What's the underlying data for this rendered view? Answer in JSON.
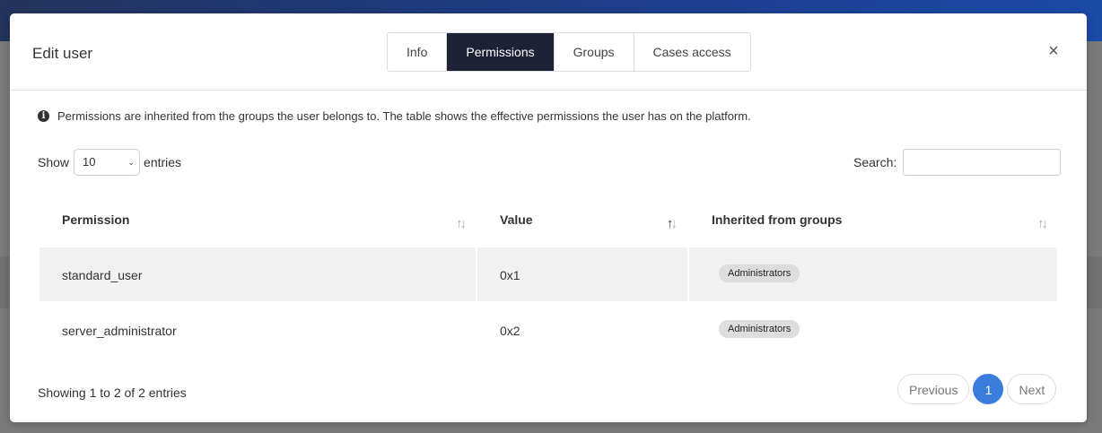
{
  "modal": {
    "title": "Edit user",
    "tabs": [
      {
        "label": "Info",
        "active": false
      },
      {
        "label": "Permissions",
        "active": true
      },
      {
        "label": "Groups",
        "active": false
      },
      {
        "label": "Cases access",
        "active": false
      }
    ],
    "close_symbol": "×"
  },
  "notice": {
    "icon": "info-circle-icon",
    "text": "Permissions are inherited from the groups the user belongs to. The table shows the effective permissions the user has on the platform."
  },
  "length_control": {
    "prefix": "Show",
    "selected": "10",
    "suffix": "entries"
  },
  "search": {
    "label": "Search:",
    "value": ""
  },
  "table": {
    "columns": [
      "Permission",
      "Value",
      "Inherited from groups"
    ],
    "sorted_column": "Value",
    "rows": [
      {
        "permission": "standard_user",
        "value": "0x1",
        "groups": [
          "Administrators"
        ]
      },
      {
        "permission": "server_administrator",
        "value": "0x2",
        "groups": [
          "Administrators"
        ]
      }
    ]
  },
  "footer": {
    "info": "Showing 1 to 2 of 2 entries",
    "previous": "Previous",
    "current_page": "1",
    "next": "Next"
  },
  "colors": {
    "active_tab": "#1e2236",
    "current_page": "#3b7ddd"
  }
}
